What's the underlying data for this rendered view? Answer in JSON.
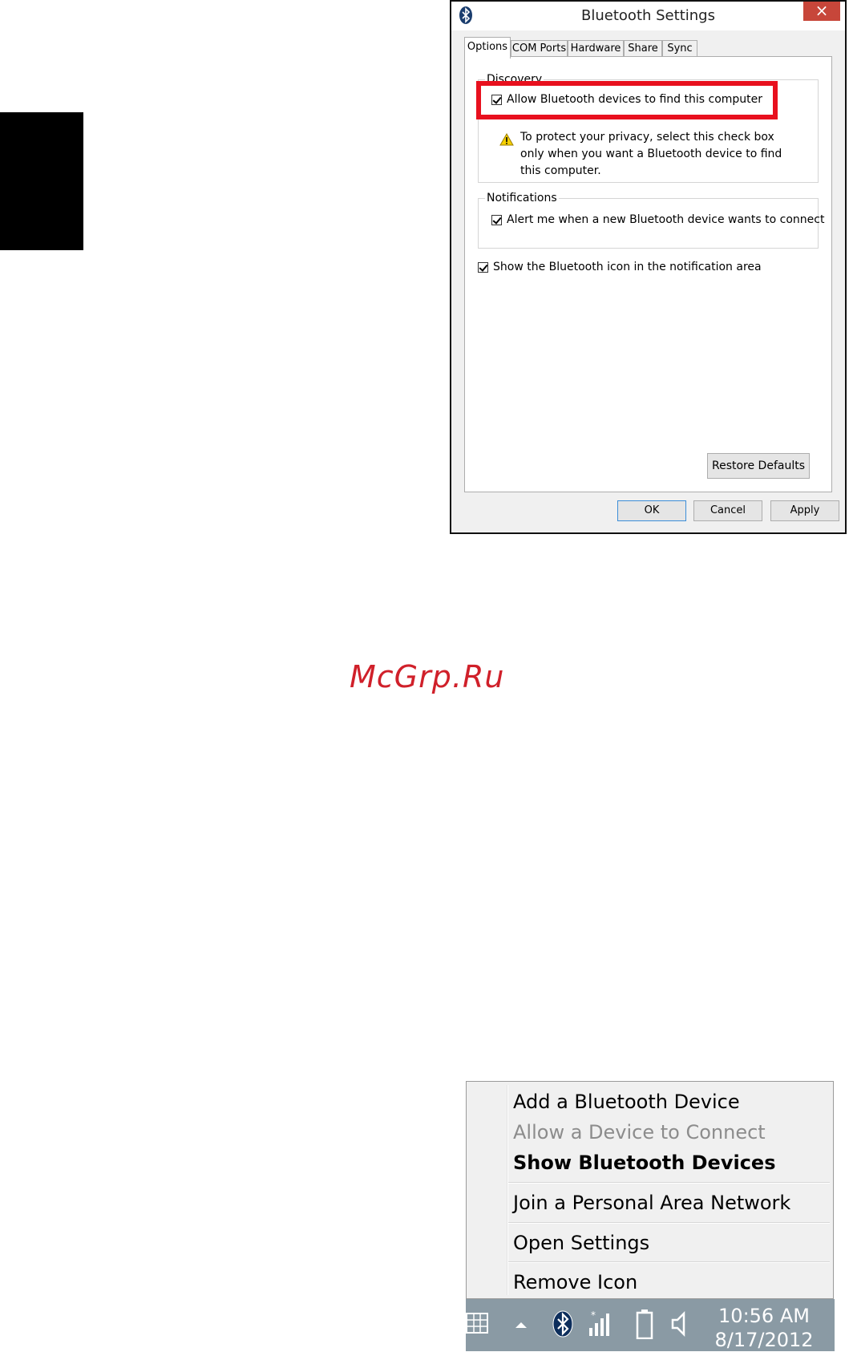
{
  "dialog": {
    "title": "Bluetooth Settings",
    "close_glyph": "×",
    "tabs": [
      {
        "label": "Options",
        "active": true
      },
      {
        "label": "COM Ports",
        "active": false
      },
      {
        "label": "Hardware",
        "active": false
      },
      {
        "label": "Share",
        "active": false
      },
      {
        "label": "Sync",
        "active": false
      }
    ],
    "discovery": {
      "legend": "Discovery",
      "allow_find_label": "Allow Bluetooth devices to find this computer",
      "allow_find_checked": true,
      "warning_text": "To protect your privacy, select this check box only when you want a Bluetooth device to find this computer."
    },
    "notifications": {
      "legend": "Notifications",
      "alert_label": "Alert me when a new Bluetooth device wants to connect",
      "alert_checked": true
    },
    "show_icon_label": "Show the Bluetooth icon in the notification area",
    "show_icon_checked": true,
    "restore_defaults_label": "Restore Defaults",
    "ok_label": "OK",
    "cancel_label": "Cancel",
    "apply_label": "Apply",
    "highlight_color": "#e8101e"
  },
  "watermark": "McGrp.Ru",
  "context_menu": {
    "items": [
      {
        "label": "Add a Bluetooth Device",
        "state": "normal"
      },
      {
        "label": "Allow a Device to Connect",
        "state": "disabled"
      },
      {
        "label": "Show Bluetooth Devices",
        "state": "bold"
      },
      {
        "label": "Join a Personal Area Network",
        "state": "normal"
      },
      {
        "label": "Open Settings",
        "state": "normal"
      },
      {
        "label": "Remove Icon",
        "state": "normal"
      }
    ]
  },
  "taskbar": {
    "icons": [
      "keyboard-icon",
      "show-hidden-icons-arrow-icon",
      "bluetooth-icon",
      "network-signal-icon",
      "battery-icon",
      "volume-icon"
    ],
    "time": "10:56 AM",
    "date": "8/17/2012"
  }
}
